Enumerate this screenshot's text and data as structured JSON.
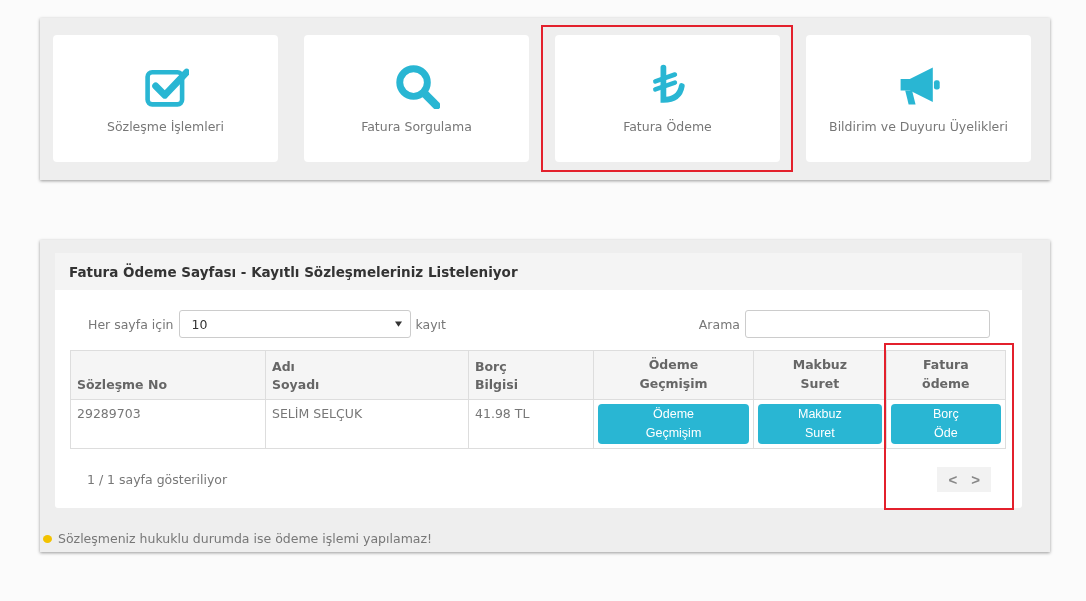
{
  "tiles": [
    {
      "kind": "check",
      "label": "Sözleşme İşlemleri",
      "highlighted": false
    },
    {
      "kind": "search",
      "label": "Fatura Sorgulama",
      "highlighted": false
    },
    {
      "kind": "lira",
      "label": "Fatura Ödeme",
      "highlighted": true
    },
    {
      "kind": "megaphone",
      "label": "Bildirim ve Duyuru Üyelikleri",
      "highlighted": false
    }
  ],
  "panel": {
    "title": "Fatura Ödeme Sayfası - Kayıtlı Sözleşmeleriniz Listeleniyor",
    "page_size_label": "Her sayfa için",
    "page_size": "10",
    "page_size_suffix": "kayıt",
    "search_label": "Arama",
    "table": {
      "columns": [
        {
          "lines": [
            "Sözleşme No"
          ],
          "highlighted": false
        },
        {
          "lines": [
            "Adı",
            "Soyadı"
          ],
          "highlighted": false
        },
        {
          "lines": [
            "Borç",
            "Bilgisi"
          ],
          "highlighted": false
        },
        {
          "lines": [
            "Ödeme",
            "Geçmişim"
          ],
          "highlighted": false
        },
        {
          "lines": [
            "Makbuz",
            "Suret"
          ],
          "highlighted": false
        },
        {
          "lines": [
            "Fatura",
            "ödeme"
          ],
          "highlighted": true
        }
      ],
      "rows": [
        {
          "cells": [
            {
              "kind": "text",
              "text": "29289703"
            },
            {
              "kind": "text",
              "text": "SELİM SELÇUK"
            },
            {
              "kind": "text",
              "text": "41.98 TL"
            },
            {
              "kind": "button",
              "lines": [
                "Ödeme",
                "Geçmişim"
              ]
            },
            {
              "kind": "button",
              "lines": [
                "Makbuz",
                "Suret"
              ]
            },
            {
              "kind": "button",
              "lines": [
                "Borç",
                "Öde"
              ]
            }
          ]
        }
      ]
    },
    "page_info": "1 / 1 sayfa gösteriliyor",
    "pager": {
      "prev": "<",
      "next": ">"
    }
  },
  "note": {
    "color": "#f2c200",
    "text": "Sözleşmeniz hukuklu durumda ise ödeme işlemi yapılamaz!"
  }
}
